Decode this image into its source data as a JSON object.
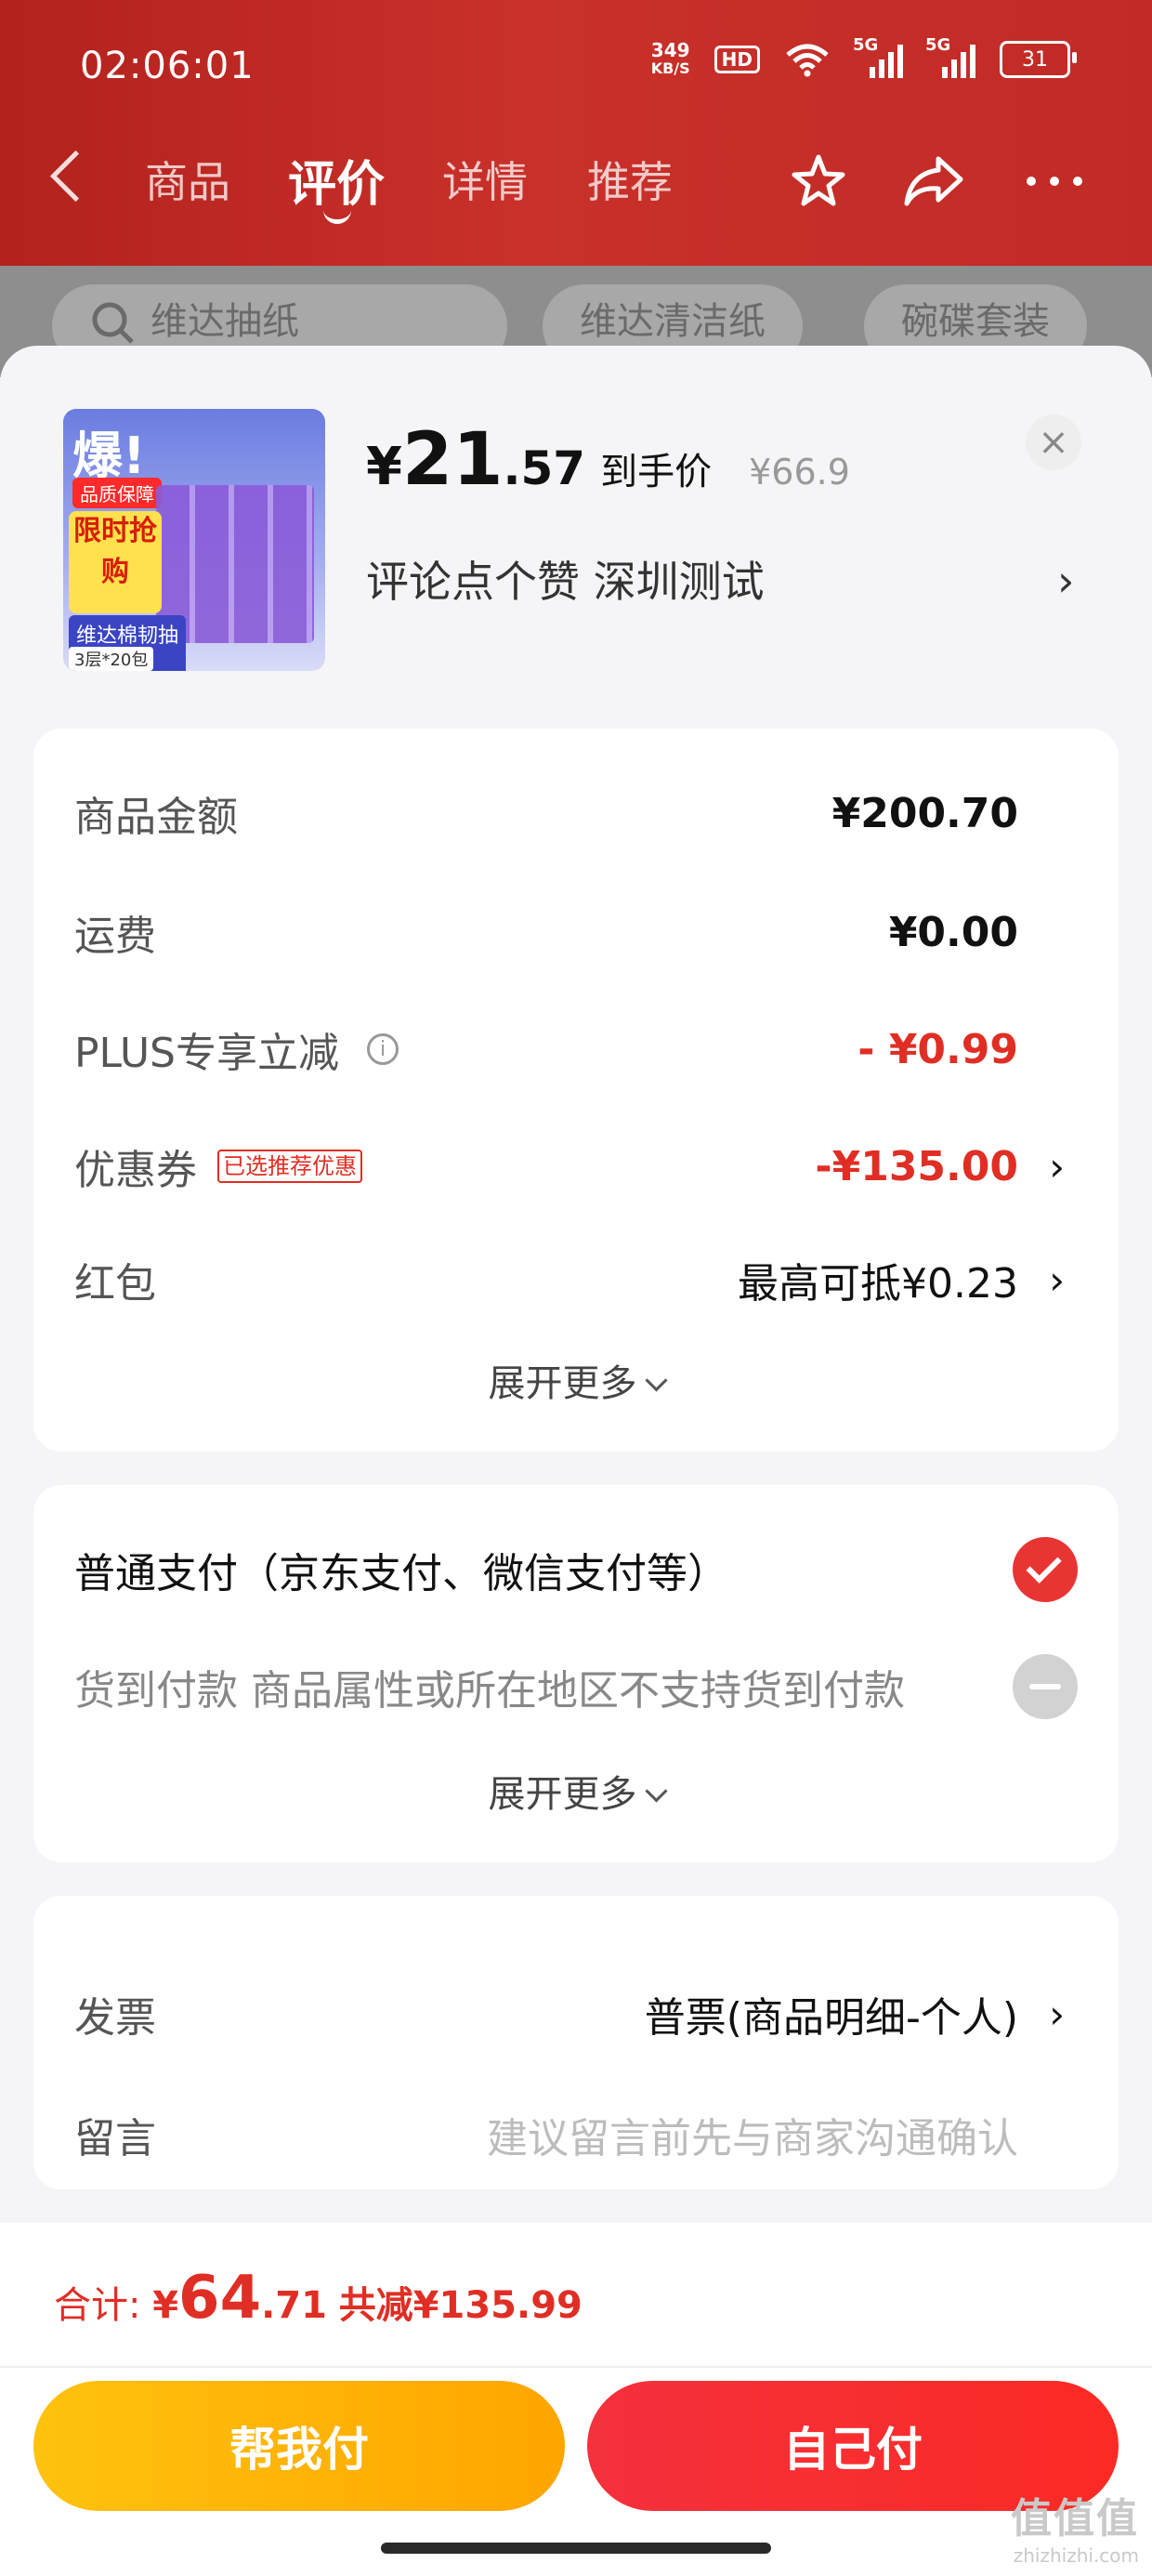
{
  "status_bar": {
    "time": "02:06:01",
    "net_speed_value": "349",
    "net_speed_unit": "KB/S",
    "hd_label": "HD",
    "signal1_label": "5G",
    "signal2_label": "5G",
    "battery": "31"
  },
  "nav": {
    "tabs": [
      "商品",
      "评价",
      "详情",
      "推荐"
    ],
    "active_tab": "评价"
  },
  "search_chips": [
    "维达抽纸",
    "维达清洁纸",
    "碗碟套装"
  ],
  "product": {
    "image_texts": {
      "boom": "爆!",
      "quality": "品质保障",
      "limited": "限时抢购",
      "brand_line": "维达棉韧抽纸",
      "spec": "3层*20包"
    },
    "currency": "¥",
    "price_int": "21",
    "price_dec": ".57",
    "price_label": "到手价",
    "original_price": "¥66.9",
    "spec_text": "评论点个赞  深圳测试"
  },
  "summary": {
    "rows": [
      {
        "label": "商品金额",
        "value": "¥200.70"
      },
      {
        "label": "运费",
        "value": "¥0.00"
      },
      {
        "label": "PLUS专享立减",
        "value": "- ¥0.99"
      },
      {
        "label": "优惠券",
        "badge": "已选推荐优惠",
        "value": "-¥135.00"
      },
      {
        "label": "红包",
        "value": "最高可抵¥0.23"
      }
    ],
    "expand_more": "展开更多"
  },
  "payment": {
    "options": [
      {
        "label": "普通支付（京东支付、微信支付等）",
        "selected": true
      },
      {
        "label": "货到付款  商品属性或所在地区不支持货到付款",
        "selected": false
      }
    ],
    "expand_more": "展开更多"
  },
  "extras": {
    "invoice_label": "发票",
    "invoice_value": "普票(商品明细-个人)",
    "message_label": "留言",
    "message_placeholder": "建议留言前先与商家沟通确认"
  },
  "footer": {
    "total_label": "合计:",
    "total_currency": "¥",
    "total_int": "64",
    "total_dec": ".71",
    "discount_text": "共减¥135.99",
    "help_pay": "帮我付",
    "self_pay": "自己付"
  },
  "watermark": {
    "logo": "值值值",
    "domain": "zhizhizhi.com"
  },
  "colors": {
    "accent_red": "#e02e24",
    "header_red": "#c12b26",
    "help_btn": "#ffb300",
    "self_btn": "#f5313d"
  }
}
